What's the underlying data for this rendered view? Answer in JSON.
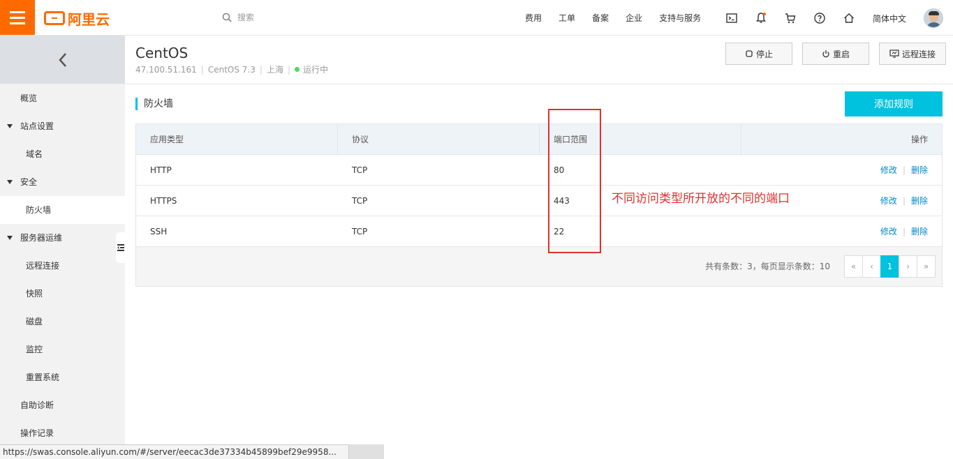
{
  "header": {
    "logo_text": "阿里云",
    "search_placeholder": "搜索",
    "nav": [
      "费用",
      "工单",
      "备案",
      "企业",
      "支持与服务"
    ],
    "language": "简体中文"
  },
  "sidebar": {
    "items": [
      {
        "label": "概览"
      },
      {
        "label": "站点设置"
      },
      {
        "label": "域名"
      },
      {
        "label": "安全"
      },
      {
        "label": "防火墙"
      },
      {
        "label": "服务器运维"
      },
      {
        "label": "远程连接"
      },
      {
        "label": "快照"
      },
      {
        "label": "磁盘"
      },
      {
        "label": "监控"
      },
      {
        "label": "重置系统"
      },
      {
        "label": "自助诊断"
      },
      {
        "label": "操作记录"
      }
    ]
  },
  "server": {
    "name": "CentOS",
    "ip": "47.100.51.161",
    "os": "CentOS 7.3",
    "region": "上海",
    "status": "运行中"
  },
  "actions": {
    "stop": "停止",
    "restart": "重启",
    "remote": "远程连接"
  },
  "firewall": {
    "title": "防火墙",
    "add_button": "添加规则",
    "columns": [
      "应用类型",
      "协议",
      "端口范围",
      "操作"
    ],
    "rows": [
      {
        "type": "HTTP",
        "protocol": "TCP",
        "port": "80",
        "edit": "修改",
        "delete": "删除"
      },
      {
        "type": "HTTPS",
        "protocol": "TCP",
        "port": "443",
        "edit": "修改",
        "delete": "删除"
      },
      {
        "type": "SSH",
        "protocol": "TCP",
        "port": "22",
        "edit": "修改",
        "delete": "删除"
      }
    ],
    "total_text": "共有条数：3，每页显示条数：10",
    "pager": {
      "first": "«",
      "prev": "‹",
      "current": "1",
      "next": "›",
      "last": "»"
    }
  },
  "annotation": {
    "text": "不同访问类型所开放的不同的端口",
    "color": "#e03030"
  },
  "statusbar": {
    "url": "https://swas.console.aliyun.com/#/server/eecac3de37334b45899bef29e9958..."
  },
  "colors": {
    "brand": "#ff6a00",
    "accent": "#00c1de",
    "link": "#0088cc",
    "running": "#4cd964"
  }
}
